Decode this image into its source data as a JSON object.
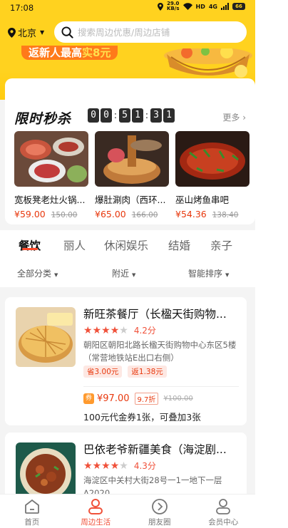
{
  "status_bar": {
    "time": "17:08",
    "speed_value": "29.0",
    "speed_unit": "KB/s",
    "network": "HD",
    "signal": "4G",
    "battery": "66"
  },
  "header": {
    "city": "北京",
    "search_placeholder": "搜索周边优惠/周边店铺",
    "banner_text_prefix": "返新人最高",
    "banner_text_highlight": "实8元"
  },
  "flash_sale": {
    "title": "限时秒杀",
    "countdown": [
      "0",
      "0",
      "5",
      "1",
      "3",
      "1"
    ],
    "more_label": "更多",
    "items": [
      {
        "name": "宽板凳老灶火锅...",
        "price": "¥59.00",
        "original": "150.00"
      },
      {
        "name": "爆肚涮肉（西环...",
        "price": "¥65.00",
        "original": "166.00"
      },
      {
        "name": "巫山烤鱼串吧",
        "price": "¥54.36",
        "original": "138.40"
      }
    ]
  },
  "category_tabs": [
    "餐饮",
    "丽人",
    "休闲娱乐",
    "结婚",
    "亲子"
  ],
  "active_tab": "餐饮",
  "filters": [
    "全部分类",
    "附近",
    "智能排序"
  ],
  "shops": [
    {
      "name": "新旺茶餐厅（长楹天街购物...",
      "stars": 4,
      "score": "4.2分",
      "address": "朝阳区朝阳北路长楹天街购物中心东区5楼（常营地铁站E出口右侧）",
      "badges": [
        "省3.00元",
        "返1.38元"
      ],
      "voucher_icon": "券",
      "voucher_price": "¥97.00",
      "voucher_discount": "9.7折",
      "voucher_original": "¥100.00",
      "voucher_desc": "100元代金券1张，可叠加3张"
    },
    {
      "name": "巴依老爷新疆美食（海淀剧...",
      "stars": 4,
      "score": "4.3分",
      "address": "海淀区中关村大街28号一1一地下一层A2020"
    }
  ],
  "bottom_nav": [
    {
      "label": "首页",
      "icon": "home-icon"
    },
    {
      "label": "周边生活",
      "icon": "person-icon"
    },
    {
      "label": "朋友圈",
      "icon": "circle-arrow-icon"
    },
    {
      "label": "会员中心",
      "icon": "user-icon"
    }
  ],
  "active_nav": "周边生活",
  "colors": {
    "brand_yellow": "#ffd21f",
    "accent_red": "#f0513a",
    "price_red": "#e8380d"
  }
}
